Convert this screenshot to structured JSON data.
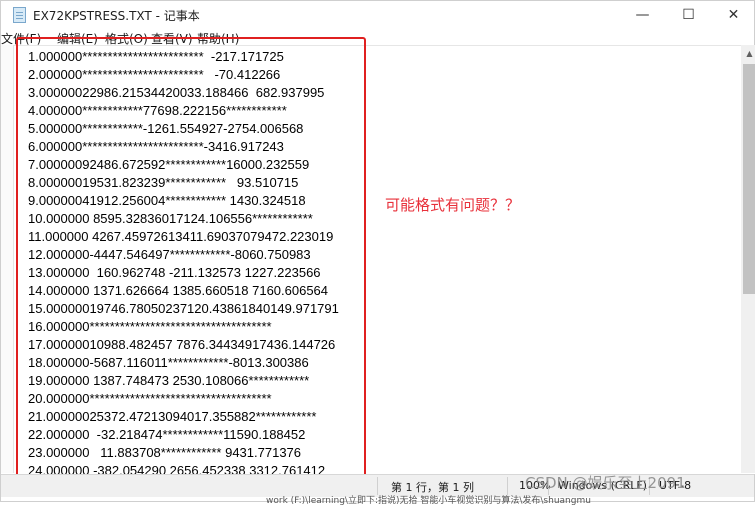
{
  "window": {
    "title": "EX72KPSTRESS.TXT - 记事本",
    "controls": {
      "minimize": "—",
      "maximize": "☐",
      "close": "✕"
    }
  },
  "menu": [
    "文件(F)",
    "编辑(E)",
    "格式(O)",
    "查看(V)",
    "帮助(H)"
  ],
  "lines": [
    "1.000000************************  -217.171725",
    "2.000000************************   -70.412266",
    "3.00000022986.21534420033.188466  682.937995",
    "4.000000************77698.222156************",
    "5.000000************-1261.554927-2754.006568",
    "6.000000************************-3416.917243",
    "7.00000092486.672592************16000.232559",
    "8.00000019531.823239************   93.510715",
    "9.00000041912.256004************ 1430.324518",
    "10.000000 8595.32836017124.106556************",
    "11.000000 4267.45972613411.69037079472.223019",
    "12.000000-4447.546497************-8060.750983",
    "13.000000  160.962748 -211.132573 1227.223566",
    "14.000000 1371.626664 1385.660518 7160.606564",
    "15.00000019746.78050237120.43861840149.971791",
    "16.000000************************************",
    "17.00000010988.482457 7876.34434917436.144726",
    "18.000000-5687.116011************-8013.300386",
    "19.000000 1387.748473 2530.108066************",
    "20.000000************************************",
    "21.00000025372.47213094017.355882************",
    "22.000000  -32.218474************11590.188452",
    "23.000000   11.883708************ 9431.771376",
    "24.000000 -382.054290 2656.452338 3312.761412"
  ],
  "annotation": "可能格式有问题？？",
  "status": {
    "position": "第 1 行，第 1 列",
    "zoom": "100%",
    "line_ending": "Windows (CRLF)",
    "encoding": "UTF-8"
  },
  "watermark": "CSDN @娱乐至上2091",
  "footer": "work (F:)\\learning\\立即下:指说)无拾 智能小车视觉识别与算法\\发布\\shuangmu",
  "colors": {
    "annotation": "#e8303a",
    "highlight_border": "#e02020"
  }
}
